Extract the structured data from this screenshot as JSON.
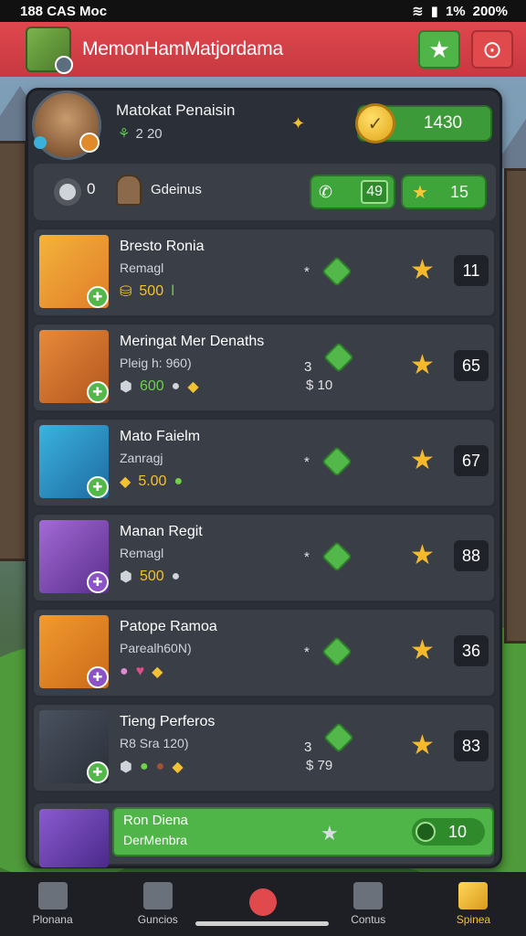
{
  "status_bar": {
    "left": "188 CAS Moc",
    "battery_label": "1%",
    "battery_pct": "200%"
  },
  "header": {
    "title": "MemonHamMatjordama"
  },
  "profile": {
    "name": "Matokat Penaisin",
    "level": "2 20",
    "coins": "1430"
  },
  "toolbar": {
    "shield_count": "0",
    "group_label": "Gdeinus",
    "call_value": "49",
    "star_value": "15"
  },
  "rows": [
    {
      "name": "Bresto Ronia",
      "sub": "Remagl",
      "res": [
        "500"
      ],
      "score": "11"
    },
    {
      "name": "Meringat Mer Denaths",
      "sub": "Pleig h: 960)",
      "res": [
        "600"
      ],
      "small": "$ 10",
      "score": "65"
    },
    {
      "name": "Mato Faielm",
      "sub": "Zanragj",
      "res": [
        "5.00"
      ],
      "score": "67"
    },
    {
      "name": "Manan Regit",
      "sub": "Remagl",
      "res": [
        "500"
      ],
      "score": "88"
    },
    {
      "name": "Patope Ramoa",
      "sub": "Parealh60N)",
      "res": [],
      "score": "36"
    },
    {
      "name": "Tieng Perferos",
      "sub": "R8 Sra 120)",
      "res": [],
      "small": "$ 79",
      "score": "83"
    }
  ],
  "highlight": {
    "name": "Ron Diena",
    "sub": "DerMenbra",
    "value": "10"
  },
  "nav": [
    "Plonana",
    "Guncios",
    "",
    "Contus",
    "Spinea"
  ]
}
